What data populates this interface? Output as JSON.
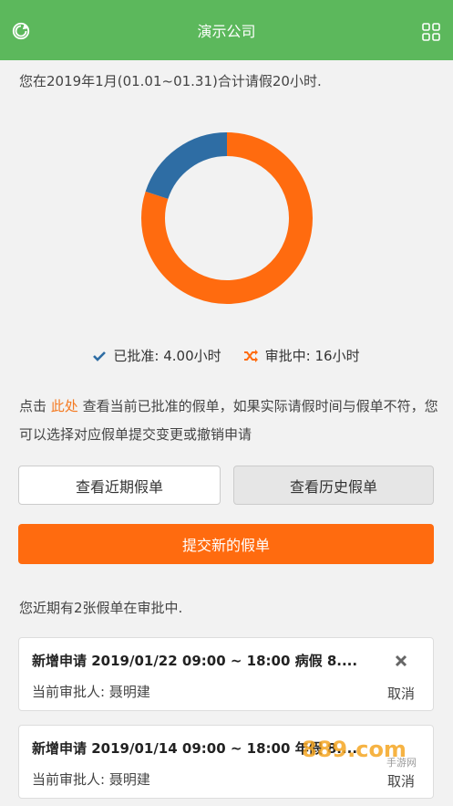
{
  "header": {
    "title": "演示公司",
    "left_icon": "refresh-icon",
    "right_icon": "grid-icon"
  },
  "summary": "您在2019年1月(01.01~01.31)合计请假20小时.",
  "chart_data": {
    "type": "pie",
    "categories": [
      "已批准",
      "审批中"
    ],
    "values": [
      4,
      16
    ],
    "colors": [
      "#2e6da4",
      "#ff6b0f"
    ]
  },
  "legend": {
    "approved": "已批准: 4.00小时",
    "pending": "审批中: 16小时",
    "approved_color": "#2e6da4",
    "pending_color": "#ff6b0f"
  },
  "desc": {
    "prefix": "点击 ",
    "link": "此处",
    "suffix": " 查看当前已批准的假单，如果实际请假时间与假单不符，您可以选择对应假单提交变更或撤销申请"
  },
  "buttons": {
    "recent": "查看近期假单",
    "history": "查看历史假单",
    "submit": "提交新的假单"
  },
  "recent_text": "您近期有2张假单在审批中.",
  "cards": [
    {
      "title": "新增申请 2019/01/22 09:00 ~ 18:00 病假 8....",
      "approver": "当前审批人: 聂明建",
      "cancel": "取消"
    },
    {
      "title": "新增申请 2019/01/14 09:00 ~ 18:00 年假 8....",
      "approver": "当前审批人: 聂明建",
      "cancel": "取消"
    }
  ],
  "watermark": {
    "main": "889.com",
    "sub": "手游网"
  }
}
